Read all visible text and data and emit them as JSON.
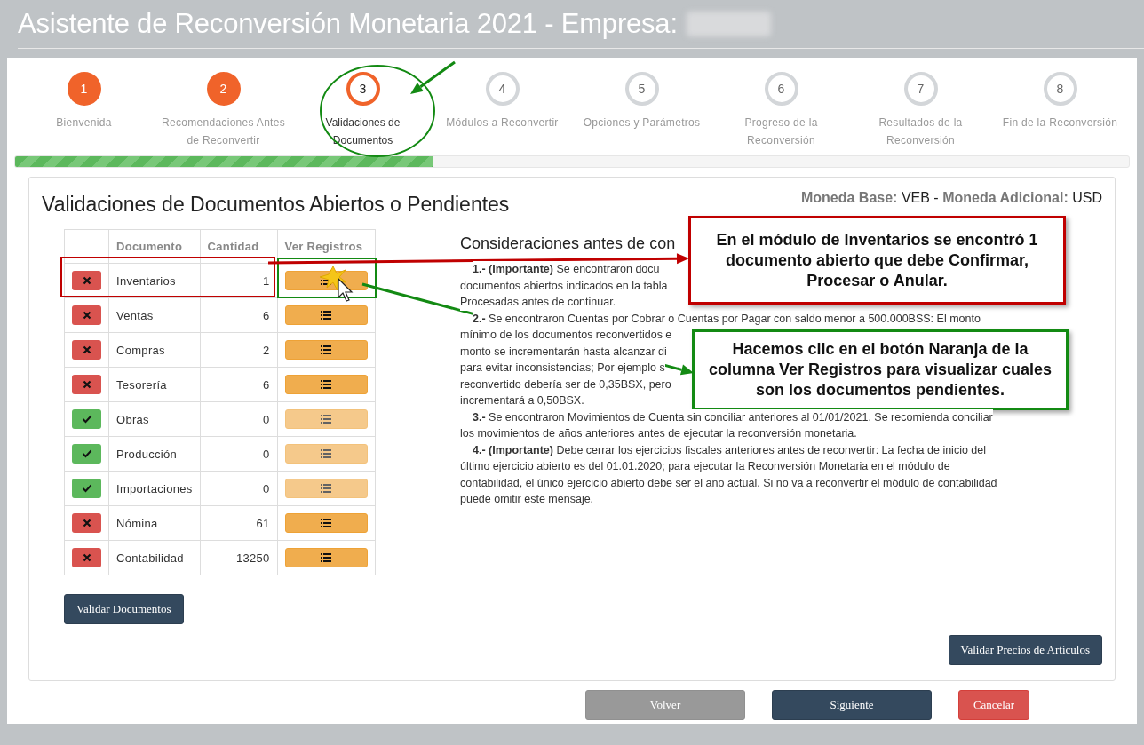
{
  "window": {
    "title": "Asistente de Reconversión Monetaria 2021 - Empresa:",
    "company_blurred": true
  },
  "steps": [
    {
      "number": "1",
      "label": "Bienvenida",
      "completed": true,
      "selected": false
    },
    {
      "number": "2",
      "label": "Recomendaciones Antes de Reconvertir",
      "completed": true,
      "selected": false
    },
    {
      "number": "3",
      "label": "Validaciones de Documentos",
      "completed": false,
      "selected": true
    },
    {
      "number": "4",
      "label": "Módulos a Reconvertir",
      "completed": false,
      "selected": false
    },
    {
      "number": "5",
      "label": "Opciones y Parámetros",
      "completed": false,
      "selected": false
    },
    {
      "number": "6",
      "label": "Progreso de la Reconversión",
      "completed": false,
      "selected": false
    },
    {
      "number": "7",
      "label": "Resultados de la Reconversión",
      "completed": false,
      "selected": false
    },
    {
      "number": "8",
      "label": "Fin de la Reconversión",
      "completed": false,
      "selected": false
    }
  ],
  "progress": {
    "level": 0.375
  },
  "card": {
    "title": "Validaciones de Documentos Abiertos o Pendientes",
    "currency": "**Moneda Base:** VEB - **Moneda Adicional:** USD"
  },
  "table": {
    "columns": [
      "Documento",
      "Cantidad",
      "Ver Registros"
    ],
    "rows": [
      {
        "ok": false,
        "document": "Inventarios",
        "count": "1",
        "disabled": false
      },
      {
        "ok": false,
        "document": "Ventas",
        "count": "6",
        "disabled": false
      },
      {
        "ok": false,
        "document": "Compras",
        "count": "2",
        "disabled": false
      },
      {
        "ok": false,
        "document": "Tesorería",
        "count": "6",
        "disabled": false
      },
      {
        "ok": true,
        "document": "Obras",
        "count": "0",
        "disabled": true
      },
      {
        "ok": true,
        "document": "Producción",
        "count": "0",
        "disabled": true
      },
      {
        "ok": true,
        "document": "Importaciones",
        "count": "0",
        "disabled": true
      },
      {
        "ok": false,
        "document": "Nómina",
        "count": "61",
        "disabled": false
      },
      {
        "ok": false,
        "document": "Contabilidad",
        "count": "13250",
        "disabled": false
      }
    ]
  },
  "validate_button": "Validar Documentos",
  "considerations": {
    "title": "Consideraciones antes de con",
    "lines": [
      {
        "kind": "lead",
        "text": "**1.-  (Importante)** Se encontraron docu"
      },
      {
        "kind": "plain",
        "text": "documentos abiertos indicados en la tabla"
      },
      {
        "kind": "plain",
        "text": "Procesadas antes de continuar."
      },
      {
        "kind": "lead",
        "text": "**2.-**  Se encontraron Cuentas por Cobrar o Cuentas por Pagar con saldo menor a 500.000BSS: El monto"
      },
      {
        "kind": "plain",
        "text": "mínimo de los documentos reconvertidos e"
      },
      {
        "kind": "plain",
        "text": "monto se incrementarán hasta alcanzar di"
      },
      {
        "kind": "plain",
        "text": "para evitar inconsistencias; Por ejemplo s"
      },
      {
        "kind": "plain",
        "text": "reconvertido debería ser de 0,35BSX, pero"
      },
      {
        "kind": "plain",
        "text": "incrementará a 0,50BSX."
      },
      {
        "kind": "lead",
        "text": "**3.-**  Se encontraron Movimientos de Cuenta sin conciliar anteriores al 01/01/2021. Se recomienda conciliar"
      },
      {
        "kind": "plain",
        "text": "los movimientos de años anteriores antes de ejecutar la reconversión monetaria."
      },
      {
        "kind": "lead",
        "text": "**4.-  (Importante)** Debe cerrar los ejercicios fiscales anteriores antes de reconvertir: La fecha de inicio del"
      },
      {
        "kind": "plain",
        "text": "último ejercicio abierto es del 01.01.2020; para ejecutar la Reconversión Monetaria en el módulo de"
      },
      {
        "kind": "plain",
        "text": "contabilidad, el único ejercicio abierto debe ser el año actual. Si no va a reconvertir el módulo de contabilidad"
      },
      {
        "kind": "plain",
        "text": "puede omitir este mensaje."
      }
    ]
  },
  "prices_button": "Validar Precios de Artículos",
  "footer_buttons": [
    {
      "label": "Volver",
      "kind": "default"
    },
    {
      "label": "Siguiente",
      "kind": "primary"
    },
    {
      "label": "Cancelar",
      "kind": "danger"
    }
  ],
  "callouts": [
    {
      "text": "En el módulo de Inventarios se encontró 1 documento abierto que debe Confirmar, Procesar o Anular.",
      "color": "#c00000"
    },
    {
      "text": "Hacemos clic en el botón Naranja de la columna Ver Registros para visualizar cuales son los documentos pendientes.",
      "color": "#138a13"
    }
  ]
}
